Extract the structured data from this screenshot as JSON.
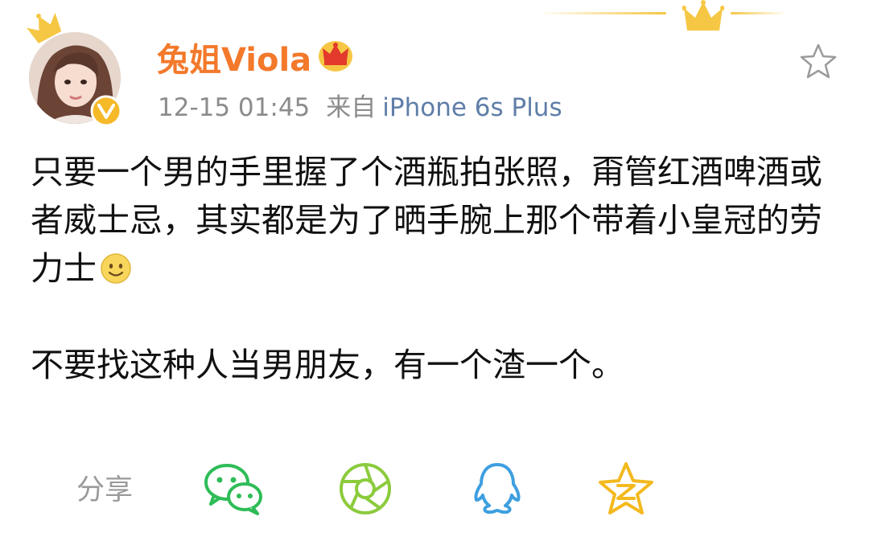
{
  "colors": {
    "username": "#f3792b",
    "meta": "#8c8c8c",
    "device_link": "#5f7ea8",
    "gold": "#f6c744",
    "wechat": "#2ebc57",
    "moments": "#8ccb3d",
    "qq": "#3e9fe0",
    "qzone": "#f3b91e"
  },
  "post": {
    "author": {
      "name": "兔姐Viola",
      "avatar_icon": "avatar",
      "verified_icon": "verified-badge-icon",
      "vip_icon": "crown-vip-icon"
    },
    "timestamp": "12-15 01:45",
    "source_prefix": "来自",
    "source_device": "iPhone 6s Plus",
    "paragraph1": "只要一个男的手里握了个酒瓶拍张照，甭管红酒啤酒或者威士忌，其实都是为了晒手腕上那个带着小皇冠的劳力士",
    "paragraph1_emoji": "smiley-icon",
    "paragraph2": "不要找这种人当男朋友，有一个渣一个。"
  },
  "share": {
    "label": "分享",
    "targets": [
      {
        "name": "wechat",
        "icon": "wechat-icon"
      },
      {
        "name": "moments",
        "icon": "moments-icon"
      },
      {
        "name": "qq",
        "icon": "qq-icon"
      },
      {
        "name": "qzone",
        "icon": "qzone-icon"
      }
    ]
  }
}
